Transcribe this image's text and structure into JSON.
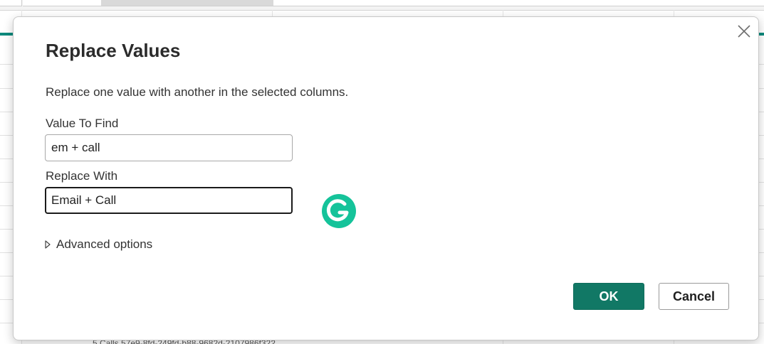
{
  "dialog": {
    "title": "Replace Values",
    "description": "Replace one value with another in the selected columns.",
    "find_label": "Value To Find",
    "find_value": "em + call",
    "replace_label": "Replace With",
    "replace_value": "Email + Call",
    "advanced_label": "Advanced options",
    "ok_label": "OK",
    "cancel_label": "Cancel",
    "close_icon": "close-icon"
  },
  "colors": {
    "accent": "#117865",
    "teal_line": "#0e8a7d",
    "grammarly": "#15c39a"
  },
  "background": {
    "partial_row_text": "5 Calls  57e9-8fd-249fd-b88-9682d-2107986f322"
  }
}
